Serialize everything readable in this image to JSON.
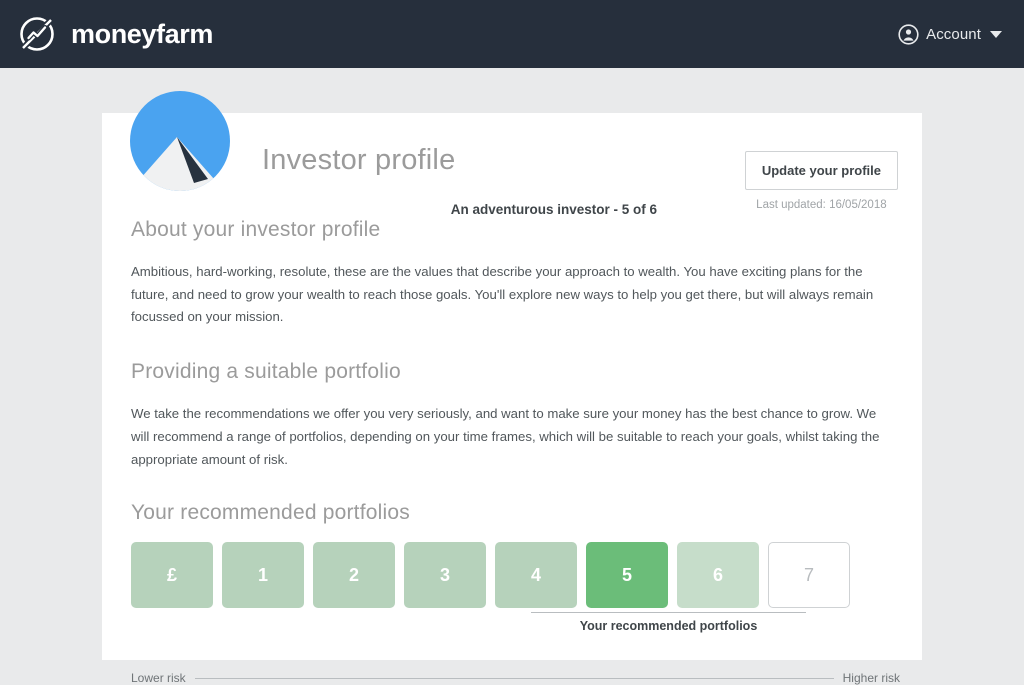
{
  "header": {
    "brand_name": "moneyfarm",
    "brand_icon": "moneyfarm-logo-icon",
    "account_label": "Account",
    "account_icon": "account-circle-icon",
    "caret_icon": "chevron-down-icon",
    "background_color": "#262f3c"
  },
  "profile": {
    "avatar_icon": "mountain-avatar-icon",
    "title": "Investor profile",
    "subtitle": "An adventurous investor - 5 of 6",
    "update_button": "Update your profile",
    "last_updated": "Last updated: 16/05/2018"
  },
  "sections": [
    {
      "heading": "About your investor profile",
      "body": "Ambitious, hard-working, resolute, these are the values that describe your approach to wealth. You have exciting plans for the future, and need to grow your wealth to reach those goals. You'll explore new ways to help you get there, but will always remain focussed on your mission."
    },
    {
      "heading": "Providing a suitable portfolio",
      "body": "We take the recommendations we offer you very seriously, and want to make sure your money has the best chance to grow. We will recommend a range of portfolios, depending on your time frames, which will be suitable to reach your goals, whilst taking the appropriate amount of risk."
    }
  ],
  "portfolios": {
    "heading": "Your recommended portfolios",
    "tiles": [
      {
        "label": "£",
        "state": "default"
      },
      {
        "label": "1",
        "state": "default"
      },
      {
        "label": "2",
        "state": "default"
      },
      {
        "label": "3",
        "state": "default"
      },
      {
        "label": "4",
        "state": "default"
      },
      {
        "label": "5",
        "state": "selected"
      },
      {
        "label": "6",
        "state": "light"
      },
      {
        "label": "7",
        "state": "empty"
      }
    ],
    "recommended_label": "Your recommended portfolios",
    "colors": {
      "default": "#b6d2bb",
      "light": "#c6ddca",
      "selected": "#6bbd79",
      "empty_border": "#cfd2d4"
    }
  },
  "risk_scale": {
    "low_label": "Lower risk",
    "high_label": "Higher risk"
  }
}
